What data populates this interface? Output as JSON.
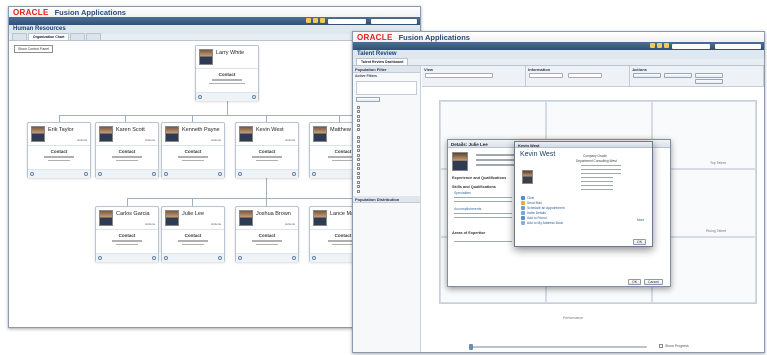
{
  "brand": {
    "oracle": "ORACLE",
    "app": "Fusion Applications"
  },
  "window1": {
    "section": "Human Resources",
    "tabs": [
      "Organization Chart"
    ],
    "control_panel": "Show Control Panel",
    "cards": [
      {
        "name": "Larry White",
        "contact": "Contact"
      },
      {
        "name": "Erik Taylor",
        "contact": "Contact"
      },
      {
        "name": "Karen Scott",
        "contact": "Contact"
      },
      {
        "name": "Kenneth Payne",
        "contact": "Contact"
      },
      {
        "name": "Kevin West",
        "contact": "Contact"
      },
      {
        "name": "Matthew Butcher",
        "contact": "Contact"
      },
      {
        "name": "Carlos Garcia",
        "contact": "Contact"
      },
      {
        "name": "Julie Lee",
        "contact": "Contact"
      },
      {
        "name": "Joshua Brown",
        "contact": "Contact"
      },
      {
        "name": "Lance Matthews",
        "contact": "Contact"
      }
    ],
    "card_action_label": "Actions"
  },
  "window2": {
    "section": "Talent Review",
    "subtab": "Talent Review Dashboard",
    "left_headers": {
      "filter": "Population Filter",
      "filters_title": "Active Filters",
      "distribution": "Population Distribution"
    },
    "top_panels": {
      "view": "View",
      "information": "Information",
      "actions": "Actions"
    },
    "performance_label": "Performance",
    "show_progress": "Show Progress",
    "details_modal": {
      "title": "Details: Julie Lee",
      "experience_section": "Experience and Qualifications",
      "skills_section": "Skills and Qualifications",
      "specialties": "Specialties",
      "accomplishments": "Accomplishments",
      "expertise_section": "Areas of Expertise",
      "ok_button": "OK",
      "cancel_button": "Cancel"
    },
    "kevin_modal": {
      "title": "Kevin West",
      "name": "Kevin West",
      "fields": [
        {
          "label": "Company",
          "value": "Oracle"
        },
        {
          "label": "Department",
          "value": "Consulting West"
        }
      ],
      "links": [
        "Chat",
        "Send Mail",
        "Schedule an Appointment",
        "Invite Details",
        "Add to Friend",
        "Add to My Address Book"
      ],
      "more_label": "More",
      "ok_button": "OK"
    },
    "grid_labels": {
      "top_center": "Potential Growth",
      "top_right": "Top Talent",
      "bottom_center": "Potential Core",
      "bottom_right": "Rising Talent"
    }
  },
  "colors": {
    "oracle_red": "#e2231a",
    "nav_blue": "#2f4f76",
    "title_blue": "#2a4d77"
  }
}
